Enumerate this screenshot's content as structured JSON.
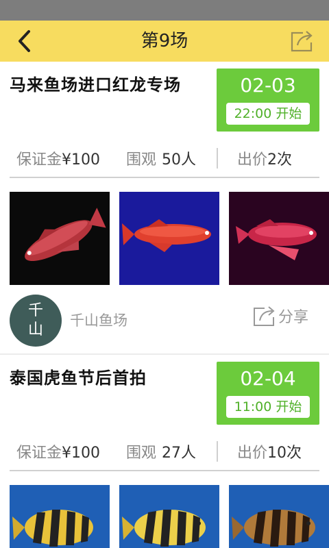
{
  "header": {
    "title": "第9场",
    "back_icon": "chevron-left-icon",
    "share_icon": "share-icon"
  },
  "colors": {
    "status_bar": "#7d7d7d",
    "nav_bar": "#f7dc5f",
    "date_box": "#6ccb3c",
    "avatar": "#3f5c59"
  },
  "auctions": [
    {
      "title": "马来鱼场进口红龙专场",
      "date": "02-03",
      "start": "22:00 开始",
      "deposit_label": "保证金",
      "deposit": "¥100",
      "watch_label": "围观",
      "watch": "50人",
      "bid_label": "出价",
      "bid": "2次",
      "seller": {
        "avatar_text": "千\n山",
        "name": "千山鱼场"
      },
      "share_label": "分享"
    },
    {
      "title": "泰国虎鱼节后首拍",
      "date": "02-04",
      "start": "11:00 开始",
      "deposit_label": "保证金",
      "deposit": "¥100",
      "watch_label": "围观",
      "watch": "27人",
      "bid_label": "出价",
      "bid": "10次"
    }
  ]
}
